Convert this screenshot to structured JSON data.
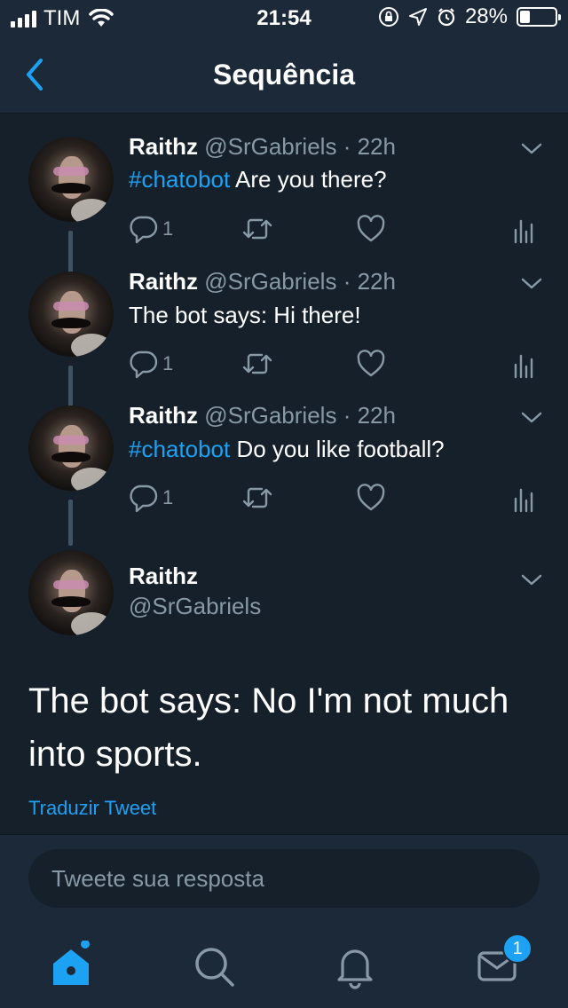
{
  "status_bar": {
    "carrier": "TIM",
    "time": "21:54",
    "battery": "28%",
    "battery_level": 0.28
  },
  "nav": {
    "title": "Sequência",
    "back_icon": "chevron-left-icon"
  },
  "tweets": [
    {
      "name": "Raithz",
      "handle": "@SrGabriels",
      "time": "· 22h",
      "hashtag": "#chatobot",
      "text": " Are you there?",
      "reply_count": "1"
    },
    {
      "name": "Raithz",
      "handle": "@SrGabriels",
      "time": "· 22h",
      "hashtag": "",
      "text": "The bot says: Hi there!",
      "reply_count": "1"
    },
    {
      "name": "Raithz",
      "handle": "@SrGabriels",
      "time": "· 22h",
      "hashtag": "#chatobot",
      "text": " Do you like football?",
      "reply_count": "1"
    }
  ],
  "detail": {
    "name": "Raithz",
    "handle": "@SrGabriels",
    "text": "The bot says: No I'm not much into sports.",
    "translate": "Traduzir Tweet"
  },
  "reply": {
    "placeholder": "Tweete sua resposta"
  },
  "tabs": {
    "items": [
      "home-icon",
      "search-icon",
      "bell-icon",
      "mail-icon"
    ],
    "messages_badge": "1"
  },
  "colors": {
    "background": "#15202b",
    "bar": "#1c2938",
    "accent": "#1da1f2",
    "muted": "#8899a6"
  }
}
